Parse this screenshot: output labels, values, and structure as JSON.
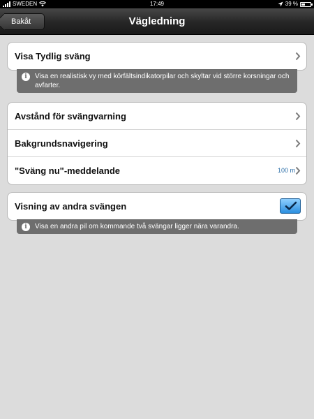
{
  "status": {
    "carrier": "SWEDEN",
    "time": "17:49",
    "battery_text": "39 %",
    "battery_level": 0.39
  },
  "nav": {
    "back_label": "Bakåt",
    "title": "Vägledning"
  },
  "group1": {
    "row": {
      "label": "Visa Tydlig sväng",
      "icon": "chevron-right-icon"
    },
    "info": "Visa en realistisk vy med körfältsindikatorpilar och skyltar vid större korsningar och avfarter."
  },
  "group2": {
    "rows": [
      {
        "label": "Avstånd för svängvarning",
        "icon": "chevron-right-icon"
      },
      {
        "label": "Bakgrundsnavigering",
        "icon": "chevron-right-icon"
      },
      {
        "label": "\"Sväng nu\"-meddelande",
        "value": "100 m",
        "icon": "chevron-right-icon"
      }
    ]
  },
  "group3": {
    "row": {
      "label": "Visning av andra svängen",
      "checked": true
    },
    "info": "Visa en andra pil om kommande två svängar ligger nära varandra."
  },
  "colors": {
    "accent": "#2c8fe0",
    "info_background": "#6e6e6e",
    "page_background": "#dcdcdc"
  }
}
